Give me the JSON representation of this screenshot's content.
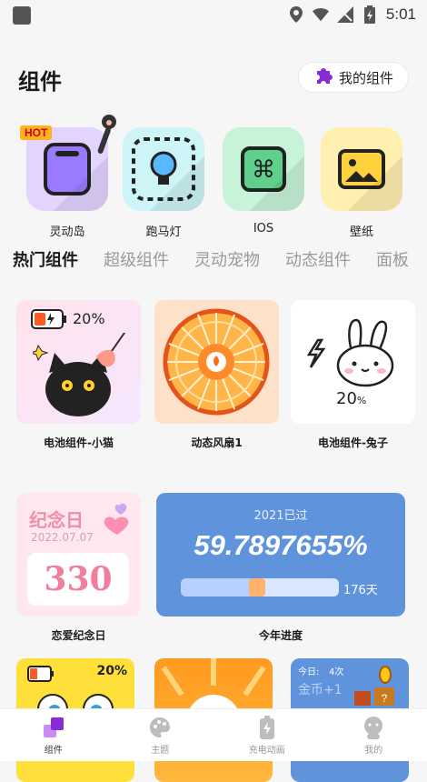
{
  "status": {
    "time": "5:01"
  },
  "header": {
    "title": "组件",
    "my_widgets": "我的组件"
  },
  "categories": [
    {
      "label": "灵动岛",
      "badge": "HOT"
    },
    {
      "label": "跑马灯"
    },
    {
      "label": "IOS"
    },
    {
      "label": "壁纸"
    }
  ],
  "tabs": [
    "热门组件",
    "超级组件",
    "灵动宠物",
    "动态组件",
    "面板"
  ],
  "cards": {
    "c1": {
      "label": "电池组件-小猫",
      "percent": "20%"
    },
    "c2": {
      "label": "动态风扇1"
    },
    "c3": {
      "label": "电池组件-兔子",
      "percent": "20",
      "unit": "%"
    },
    "c4": {
      "label": "恋爱纪念日",
      "title": "纪念日",
      "date": "2022.07.07",
      "days": "330"
    },
    "c5": {
      "label": "今年进度",
      "heading": "2021已过",
      "value": "59.7897655%",
      "days": "176天",
      "progress": 0.48
    },
    "c6": {
      "percent": "20%"
    },
    "c8": {
      "today": "今日:",
      "count": "4次",
      "coin": "金币+1"
    }
  },
  "nav": [
    {
      "label": "组件"
    },
    {
      "label": "主题"
    },
    {
      "label": "充电动画"
    },
    {
      "label": "我的"
    }
  ]
}
